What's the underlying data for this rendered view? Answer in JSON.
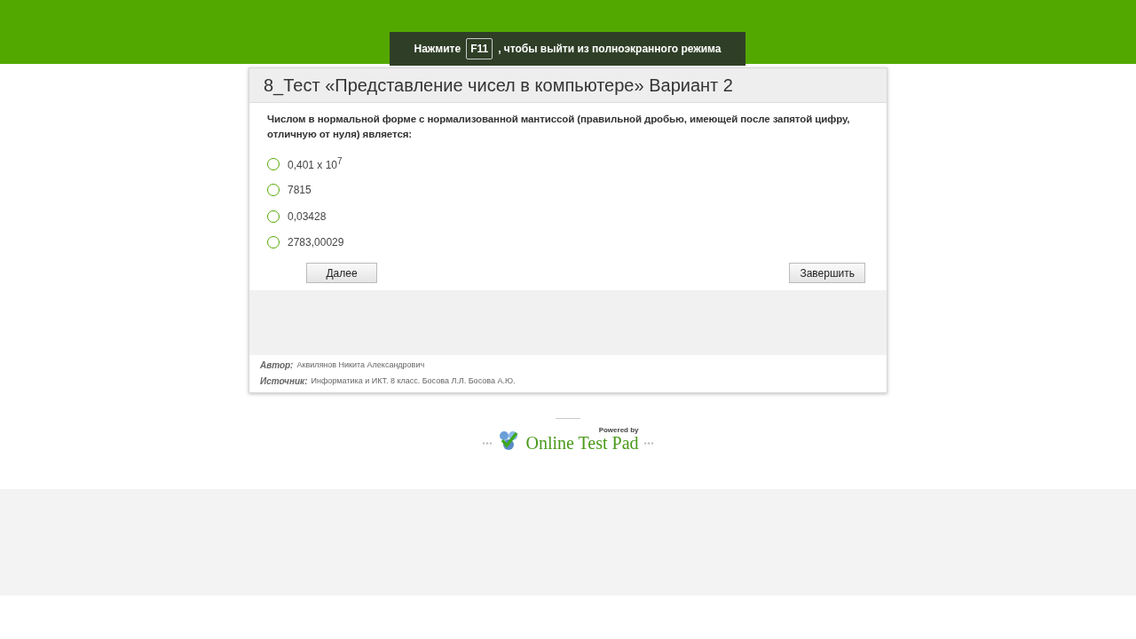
{
  "fullscreen_notice": {
    "before": "Нажмите",
    "key": "F11",
    "after": ", чтобы выйти из полноэкранного режима"
  },
  "test": {
    "title": "8_Тест «Представление чисел в компьютере» Вариант 2",
    "question": "Числом в нормальной форме с нормализованной мантиссой (правильной дробью, имеющей после запятой цифру, отличную от нуля) является:",
    "options": [
      {
        "label": "0,401 x 10$^{7}$",
        "selected": false
      },
      {
        "label": "7815",
        "selected": false
      },
      {
        "label": "0,03428",
        "selected": false
      },
      {
        "label": "2783,00029",
        "selected": false
      }
    ],
    "buttons": {
      "next": "Далее",
      "finish": "Завершить"
    },
    "meta": [
      {
        "key": "Автор:",
        "value": "Аквилянов Никита Александрович"
      },
      {
        "key": "Источник:",
        "value": "Информатика и ИКТ. 8 класс. Босова Л.Л. Босова А.Ю."
      }
    ]
  },
  "powered": {
    "caption": "Powered by",
    "brand": "Online Test Pad"
  }
}
